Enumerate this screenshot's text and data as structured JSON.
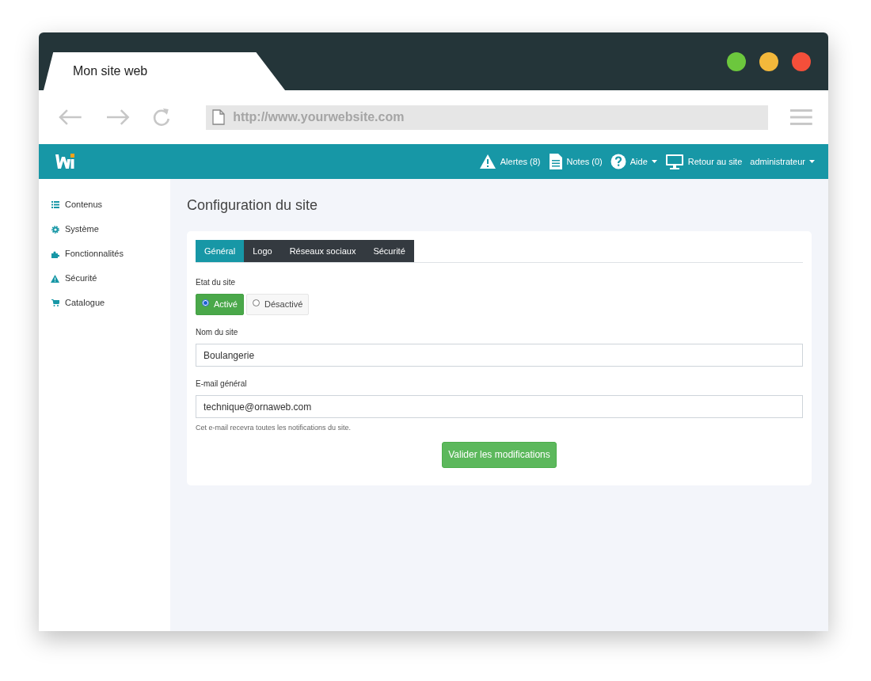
{
  "browser": {
    "tab_title": "Mon site web",
    "url": "http://www.**yourwebsite**.com"
  },
  "navbar": {
    "items": [
      {
        "kind": "alert",
        "label": "Alertes (8)",
        "dropdown": false
      },
      {
        "kind": "note",
        "label": "Notes (0)",
        "dropdown": false
      },
      {
        "kind": "help",
        "label": "Aide",
        "dropdown": true
      },
      {
        "kind": "monitor",
        "label": "Retour au site",
        "dropdown": false
      },
      {
        "kind": "account",
        "label": "administrateur",
        "dropdown": true
      }
    ]
  },
  "sidebar": {
    "items": [
      {
        "kind": "list",
        "label": "Contenus"
      },
      {
        "kind": "gear",
        "label": "Système"
      },
      {
        "kind": "puzzle",
        "label": "Fonctionnalités"
      },
      {
        "kind": "alert",
        "label": "Sécurité"
      },
      {
        "kind": "cart",
        "label": "Catalogue"
      }
    ]
  },
  "page_title": "Configuration du site",
  "tabs": [
    {
      "label": "Général",
      "selected": true
    },
    {
      "label": "Logo",
      "selected": false
    },
    {
      "label": "Réseaux sociaux",
      "selected": false
    },
    {
      "label": "Sécurité",
      "selected": false
    }
  ],
  "site_state": {
    "label": "Etat du site",
    "options": [
      {
        "label": "Activé",
        "selected": true
      },
      {
        "label": "Désactivé",
        "selected": false
      }
    ]
  },
  "site_name": {
    "label": "Nom du site",
    "value": "Boulangerie"
  },
  "email": {
    "label": "E-mail général",
    "value": "technique@ornaweb.com",
    "help": "Cet e-mail recevra toutes les notifications du site."
  },
  "submit": "Valider les modifications"
}
